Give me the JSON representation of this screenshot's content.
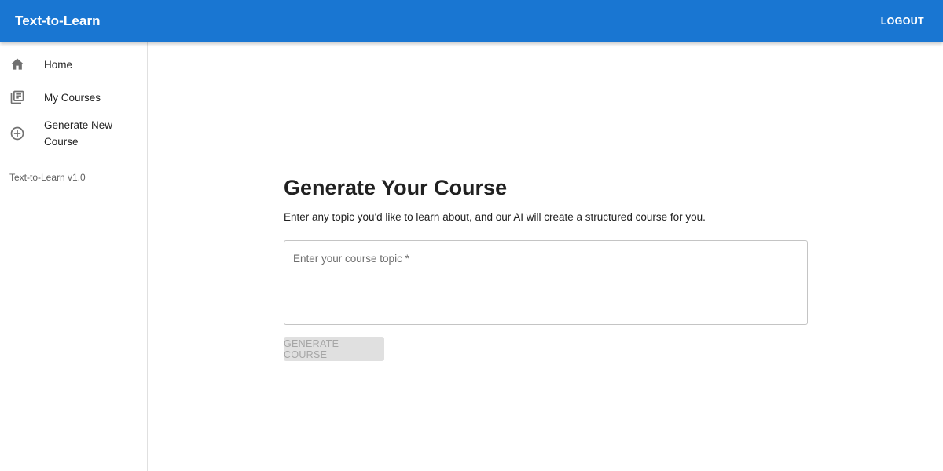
{
  "appbar": {
    "title": "Text-to-Learn",
    "logout_label": "LOGOUT",
    "color": "#1976d2"
  },
  "sidebar": {
    "items": [
      {
        "label": "Home",
        "icon": "home-icon"
      },
      {
        "label": "My Courses",
        "icon": "library-books-icon"
      },
      {
        "label": "Generate New Course",
        "icon": "add-circle-outline-icon"
      }
    ],
    "version": "Text-to-Learn v1.0"
  },
  "main": {
    "title": "Generate Your Course",
    "subtitle": "Enter any topic you'd like to learn about, and our AI will create a structured course for you.",
    "topic_placeholder": "Enter your course topic *",
    "generate_label": "GENERATE COURSE",
    "generate_disabled": true
  }
}
